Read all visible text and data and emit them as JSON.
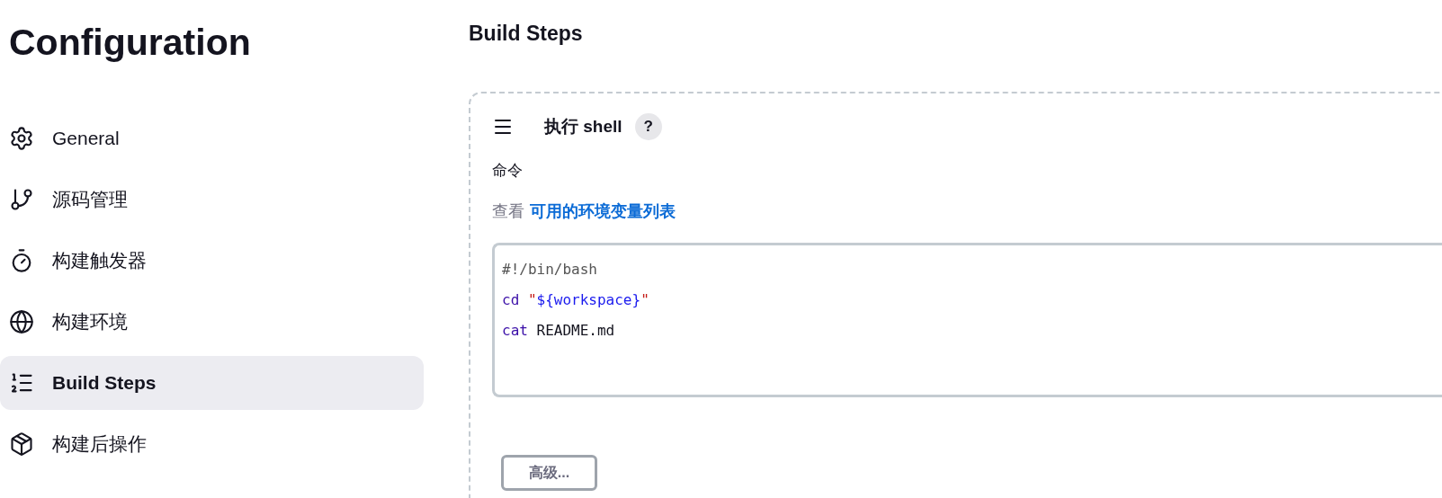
{
  "sidebar": {
    "title": "Configuration",
    "items": [
      {
        "label": "General",
        "selected": false
      },
      {
        "label": "源码管理",
        "selected": false
      },
      {
        "label": "构建触发器",
        "selected": false
      },
      {
        "label": "构建环境",
        "selected": false
      },
      {
        "label": "Build Steps",
        "selected": true
      },
      {
        "label": "构建后操作",
        "selected": false
      }
    ]
  },
  "main": {
    "heading": "Build Steps",
    "step": {
      "title": "执行 shell",
      "help": "?",
      "field_label": "命令",
      "hint_prefix": "查看",
      "hint_link": "可用的环境变量列表",
      "code": [
        [
          {
            "kind": "comment",
            "text": "#!/bin/bash"
          }
        ],
        [
          {
            "kind": "keyword",
            "text": "cd"
          },
          {
            "kind": "quote",
            "text": "\""
          },
          {
            "kind": "variable",
            "text": "${workspace}"
          },
          {
            "kind": "quote",
            "text": "\""
          }
        ],
        [
          {
            "kind": "keyword",
            "text": "cat"
          },
          {
            "kind": "plain",
            "text": "README.md"
          }
        ]
      ],
      "advanced_button": "高级..."
    }
  }
}
